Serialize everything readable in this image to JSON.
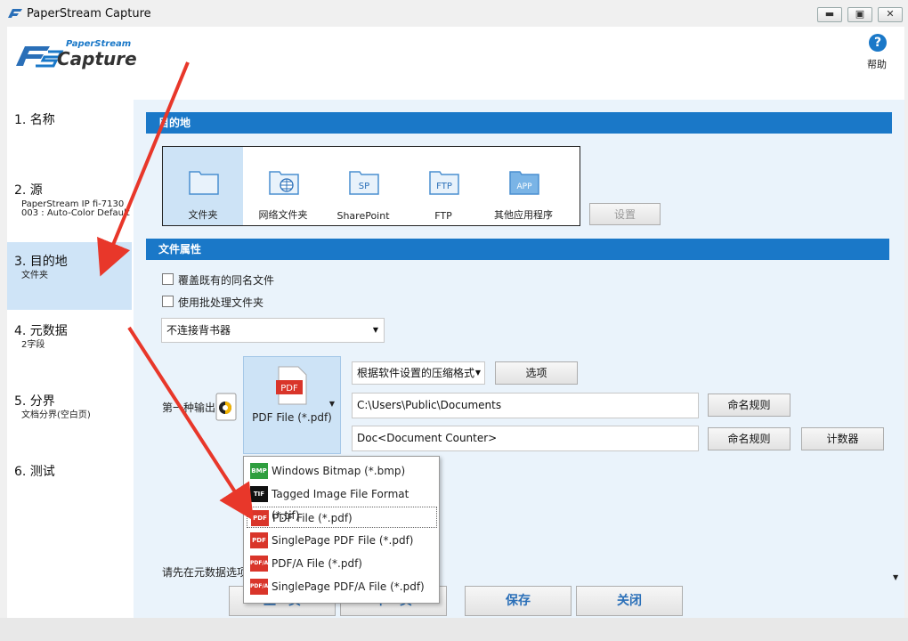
{
  "window": {
    "title": "PaperStream Capture",
    "min": "▬",
    "max": "▣",
    "close": "✕"
  },
  "header": {
    "logo_top": "PaperStream",
    "logo_bottom": "Capture",
    "help_label": "帮助",
    "help_icon": "?"
  },
  "steps": [
    {
      "label": "1. 名称",
      "sub": ""
    },
    {
      "label": "2. 源",
      "sub": "PaperStream IP fi-7130 003 : Auto-Color Default"
    },
    {
      "label": "3. 目的地",
      "sub": "文件夹"
    },
    {
      "label": "4. 元数据",
      "sub": "2字段"
    },
    {
      "label": "5. 分界",
      "sub": "文档分界(空白页)"
    },
    {
      "label": "6. 测试",
      "sub": ""
    }
  ],
  "destination": {
    "section_title": "目的地",
    "tiles": [
      {
        "label": "文件夹",
        "icon": "folder-icon"
      },
      {
        "label": "网络文件夹",
        "icon": "network-folder-icon"
      },
      {
        "label": "SharePoint",
        "icon": "sharepoint-icon",
        "badge": "SP"
      },
      {
        "label": "FTP",
        "icon": "ftp-icon",
        "badge": "FTP"
      },
      {
        "label": "其他应用程序",
        "icon": "app-icon",
        "badge": "APP"
      }
    ],
    "settings_button": "设置"
  },
  "file_props": {
    "section_title": "文件属性",
    "overwrite_label": "覆盖既有的同名文件",
    "batch_label": "使用批处理文件夹",
    "endorser_value": "不连接背书器",
    "output_label": "第一种输出",
    "format_label": "PDF File (*.pdf)",
    "format_badge": "PDF",
    "compression_value": "根据软件设置的压缩格式",
    "options_button": "选项",
    "path_value": "C:\\Users\\Public\\Documents",
    "naming_rule_1": "命名规则",
    "filename_value": "Doc<Document Counter>",
    "naming_rule_2": "命名规则",
    "counter_button": "计数器",
    "hint_text": "请先在元数据选项"
  },
  "format_menu": [
    {
      "label": "Windows Bitmap (*.bmp)",
      "icon": "BMP",
      "color": "#2e9e3e"
    },
    {
      "label": "Tagged Image File Format (*.tif)",
      "icon": "TIF",
      "color": "#111111"
    },
    {
      "label": "PDF File (*.pdf)",
      "icon": "PDF",
      "color": "#d9352a"
    },
    {
      "label": "SinglePage PDF File (*.pdf)",
      "icon": "PDF",
      "color": "#d9352a"
    },
    {
      "label": "PDF/A File (*.pdf)",
      "icon": "PDF/A",
      "color": "#d9352a"
    },
    {
      "label": "SinglePage PDF/A File (*.pdf)",
      "icon": "PDF/A",
      "color": "#d9352a"
    }
  ],
  "bottom": {
    "prev": "上一页",
    "next": "下一页",
    "save": "保存",
    "close": "关闭"
  },
  "colors": {
    "accent": "#1a78c8",
    "selected": "#cfe4f7"
  }
}
